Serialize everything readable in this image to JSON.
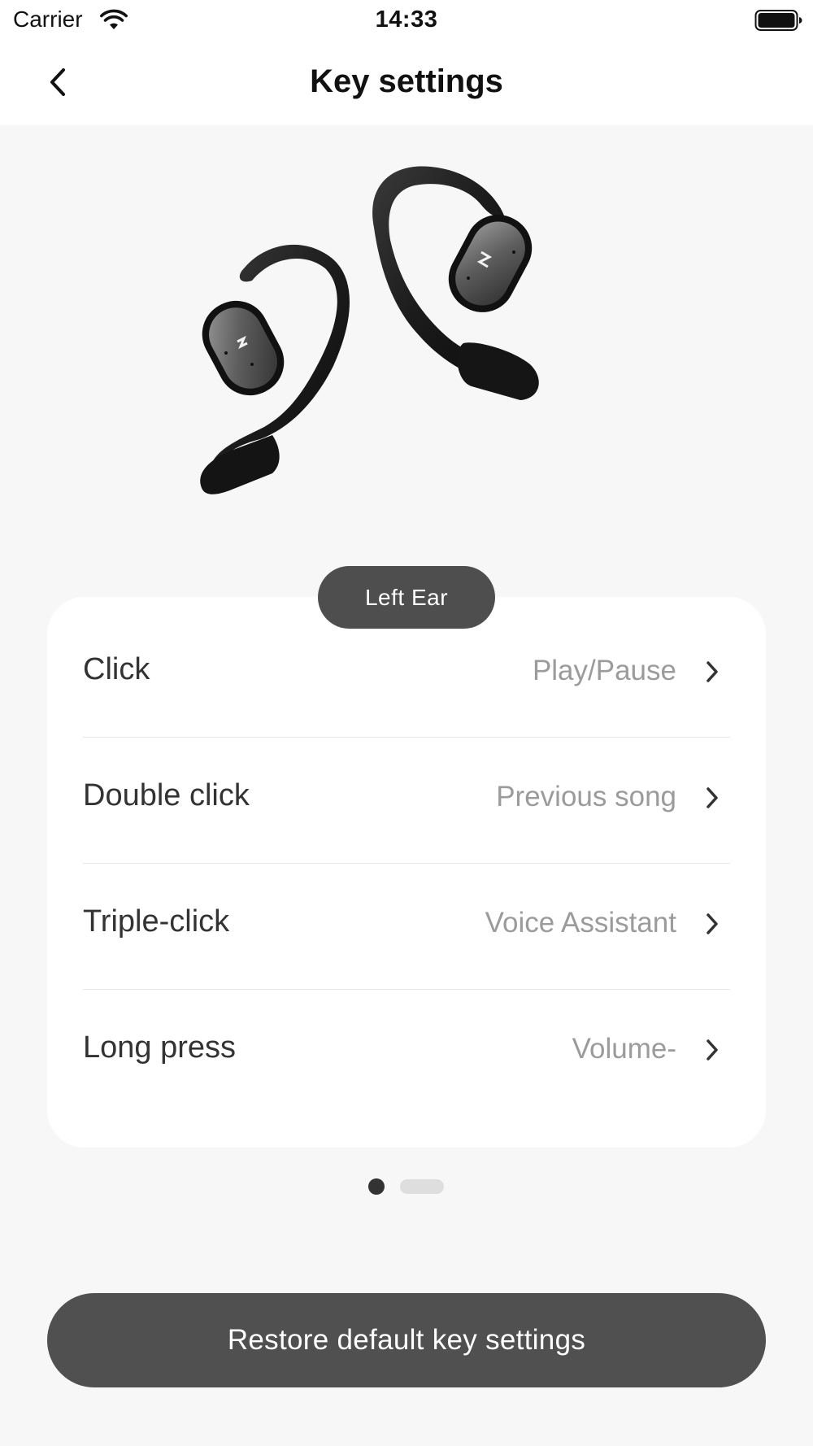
{
  "status_bar": {
    "carrier": "Carrier",
    "time": "14:33",
    "wifi_icon": "wifi-icon",
    "battery_icon": "battery-icon"
  },
  "nav": {
    "title": "Key settings",
    "back_icon": "chevron-left-icon"
  },
  "ear_selector": {
    "label": "Left Ear"
  },
  "settings": [
    {
      "label": "Click",
      "value": "Play/Pause"
    },
    {
      "label": "Double click",
      "value": "Previous song"
    },
    {
      "label": "Triple-click",
      "value": "Voice Assistant"
    },
    {
      "label": "Long press",
      "value": "Volume-"
    }
  ],
  "pager": {
    "pages": 2,
    "current": 1
  },
  "restore_button": {
    "label": "Restore default key settings"
  },
  "colors": {
    "pill_bg": "#4e4e4e",
    "button_bg": "#505050",
    "value_text": "#9b9b9b",
    "page_bg": "#f7f7f7"
  }
}
